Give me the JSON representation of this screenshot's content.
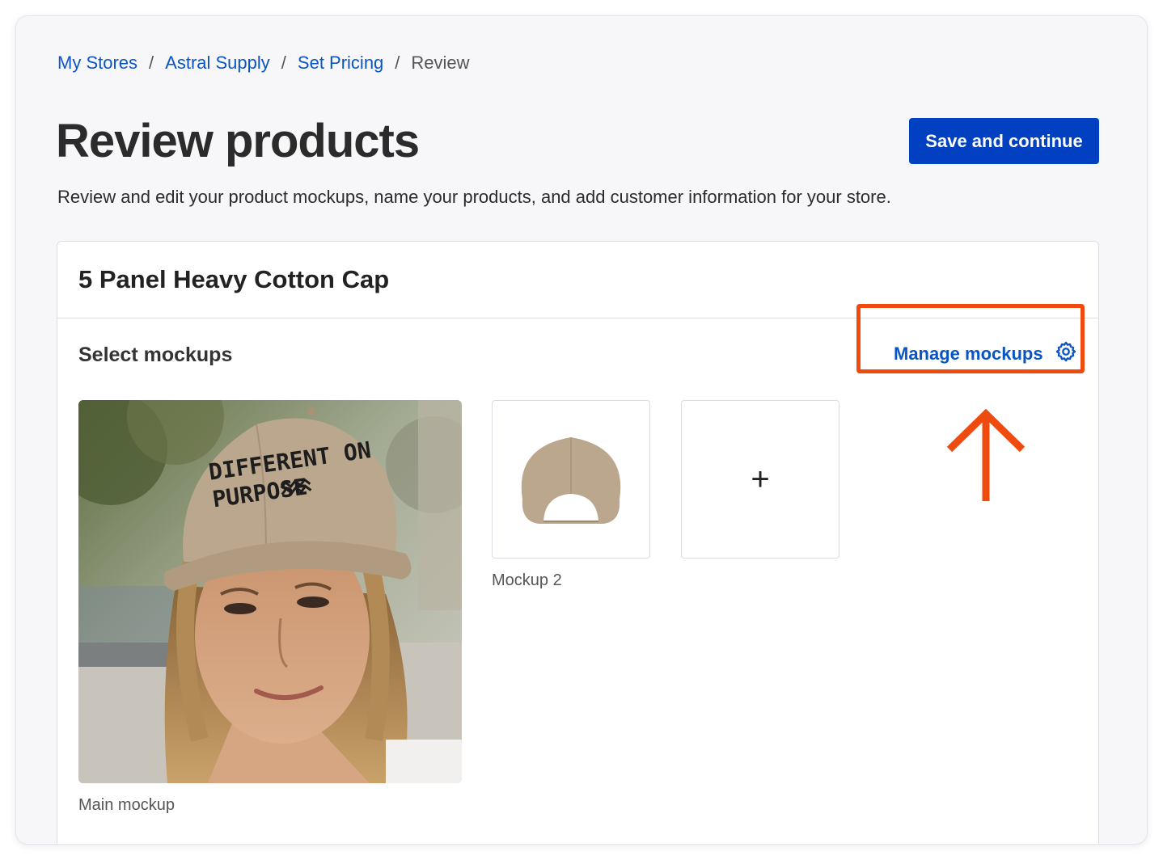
{
  "breadcrumb": {
    "items": [
      "My Stores",
      "Astral Supply",
      "Set Pricing"
    ],
    "separator": "/",
    "current": "Review"
  },
  "header": {
    "title": "Review products",
    "save_label": "Save and continue",
    "subtitle": "Review and edit your product mockups, name your products, and add customer information for your store."
  },
  "product": {
    "name": "5 Panel Heavy Cotton Cap",
    "section_title": "Select mockups",
    "manage_label": "Manage mockups",
    "manage_icon": "gear-icon",
    "main_mockup": {
      "label": "Main mockup",
      "hat_text_line1": "DIFFERENT ON",
      "hat_text_line2": "PURPOSE"
    },
    "mockups": [
      {
        "label": "Mockup 2",
        "icon": "cap-back-image"
      }
    ],
    "add_mockup_icon": "+"
  },
  "annotation": {
    "color": "#f04b0f",
    "icon": "arrow-up-icon"
  },
  "colors": {
    "link": "#0a55c6",
    "primary_button": "#0040c1",
    "cap_khaki": "#bba78d"
  }
}
